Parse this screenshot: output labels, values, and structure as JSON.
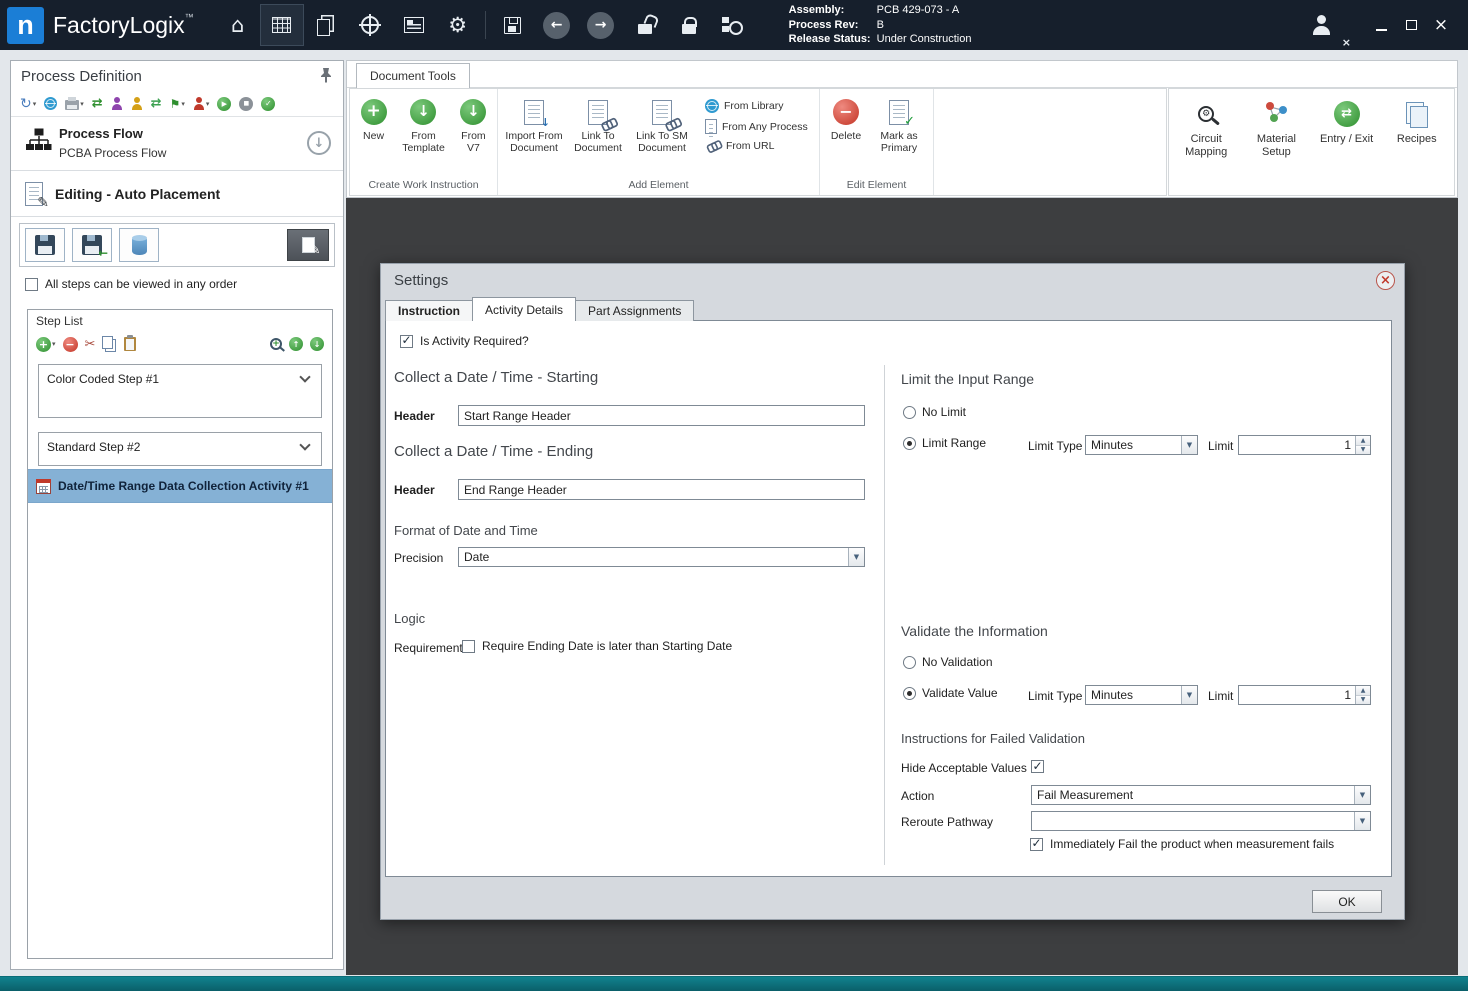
{
  "titlebar": {
    "logo_letter": "n",
    "app_name": "FactoryLogix",
    "trademark": "™",
    "info": {
      "assembly_label": "Assembly:",
      "assembly_value": "PCB 429-073 - A",
      "process_rev_label": "Process Rev:",
      "process_rev_value": "B",
      "release_status_label": "Release Status:",
      "release_status_value": "Under Construction"
    }
  },
  "sidebar": {
    "title": "Process Definition",
    "process_flow_title": "Process Flow",
    "process_flow_subtitle": "PCBA Process Flow",
    "editing_label": "Editing - Auto Placement",
    "order_checkbox_label": "All steps can be viewed in any order",
    "step_list_title": "Step List",
    "steps": [
      {
        "label": "Color Coded Step #1"
      },
      {
        "label": "Standard Step #2"
      }
    ],
    "selected_activity": "Date/Time Range Data Collection Activity #1"
  },
  "ribbon": {
    "tab_label": "Document Tools",
    "create_group": {
      "label": "Create Work Instruction",
      "new": "New",
      "from_template": "From Template",
      "from_v7": "From V7"
    },
    "add_group": {
      "label": "Add Element",
      "import_from_document": "Import From Document",
      "link_to_document": "Link To Document",
      "link_to_sm_document": "Link To SM Document",
      "from_library": "From Library",
      "from_any_process": "From Any Process",
      "from_url": "From URL"
    },
    "edit_group": {
      "label": "Edit Element",
      "delete": "Delete",
      "mark_as_primary": "Mark as Primary"
    },
    "right_group": {
      "circuit_mapping": "Circuit Mapping",
      "material_setup": "Material Setup",
      "entry_exit": "Entry / Exit",
      "recipes": "Recipes"
    }
  },
  "dialog": {
    "title": "Settings",
    "tabs": {
      "instruction": "Instruction",
      "activity_details": "Activity Details",
      "part_assignments": "Part Assignments"
    },
    "is_activity_required_label": "Is Activity Required?",
    "starting_heading": "Collect a Date / Time - Starting",
    "ending_heading": "Collect a Date / Time - Ending",
    "header_label": "Header",
    "start_header_value": "Start Range Header",
    "end_header_value": "End Range Header",
    "format_heading": "Format of Date and Time",
    "precision_label": "Precision",
    "precision_value": "Date",
    "logic_heading": "Logic",
    "requirement_label": "Requirement",
    "requirement_checkbox_label": "Require Ending Date is later than Starting Date",
    "limit_heading": "Limit the Input Range",
    "no_limit_label": "No Limit",
    "limit_range_label": "Limit Range",
    "limit_type_label": "Limit Type",
    "limit_type_value": "Minutes",
    "limit_label": "Limit",
    "limit_value": "1",
    "validate_heading": "Validate the Information",
    "no_validation_label": "No Validation",
    "validate_value_label": "Validate Value",
    "validate_type_value": "Minutes",
    "validate_limit_value": "1",
    "failed_heading": "Instructions for Failed Validation",
    "hide_acceptable_label": "Hide Acceptable Values",
    "action_label": "Action",
    "action_value": "Fail Measurement",
    "reroute_label": "Reroute Pathway",
    "reroute_value": "",
    "fail_checkbox_label": "Immediately Fail the product when measurement fails",
    "ok_label": "OK"
  },
  "colors": {
    "titlebar": "#161f2c",
    "logo_blue": "#1b7ed6",
    "selected_step": "#85b1d5",
    "statusbar_teal": "#11828e",
    "dialog_bg": "#d5d9de"
  },
  "glyphs": {
    "plus": "+",
    "minus": "−",
    "down_arrow": "↓",
    "up_arrow": "↑",
    "left_arrow": "←",
    "right_arrow": "→",
    "swap": "⇄",
    "check": "✓",
    "gear": "⚙",
    "home": "⌂",
    "scissors": "✂",
    "pencil": "✎",
    "flag": "⚑",
    "refresh": "↻",
    "play": "▶",
    "square": "■",
    "dropdown": "▼",
    "spin_up": "▲",
    "spin_down": "▼",
    "close": "×",
    "chevron": "▾"
  }
}
